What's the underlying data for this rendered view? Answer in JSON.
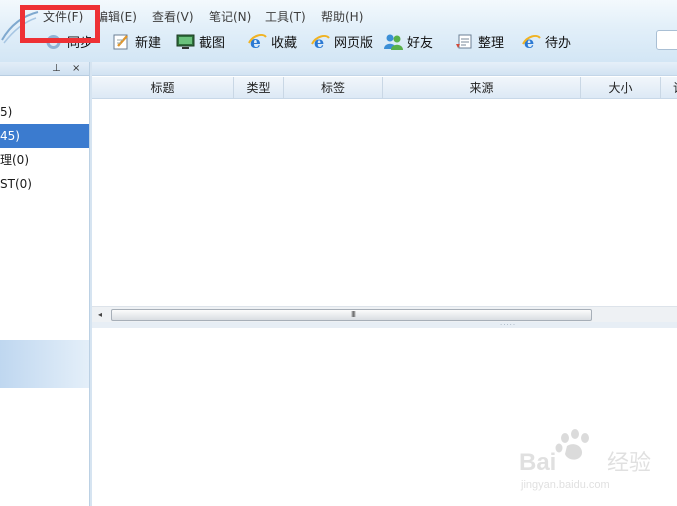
{
  "menubar": {
    "items": [
      {
        "label": "文件(F)"
      },
      {
        "label": "编辑(E)"
      },
      {
        "label": "查看(V)"
      },
      {
        "label": "笔记(N)"
      },
      {
        "label": "工具(T)"
      },
      {
        "label": "帮助(H)"
      }
    ]
  },
  "toolbar": {
    "buttons": [
      {
        "label": "同步",
        "icon": "sync-icon"
      },
      {
        "label": "新建",
        "icon": "new-note-icon"
      },
      {
        "label": "截图",
        "icon": "screenshot-icon"
      },
      {
        "label": "收藏",
        "icon": "ie-favorite-icon"
      },
      {
        "label": "网页版",
        "icon": "web-version-icon"
      },
      {
        "label": "好友",
        "icon": "friends-icon"
      },
      {
        "label": "整理",
        "icon": "organize-icon"
      },
      {
        "label": "待办",
        "icon": "todo-icon"
      }
    ]
  },
  "left_panel": {
    "pin_glyph": "⊥",
    "close_glyph": "×",
    "tree_items": [
      {
        "label": "5)",
        "selected": false
      },
      {
        "label": "45)",
        "selected": true
      },
      {
        "label": "理(0)",
        "selected": false
      },
      {
        "label": "ST(0)",
        "selected": false
      }
    ]
  },
  "list_view": {
    "columns": [
      "标题",
      "类型",
      "标签",
      "来源",
      "大小",
      "记"
    ]
  },
  "scrollbar": {
    "left_arrow": "◂",
    "grip": "III"
  },
  "watermark": {
    "brand": "Bai",
    "brand_suffix": "经验",
    "url": "jingyan.baidu.com"
  },
  "colors": {
    "highlight": "#ee3135",
    "selection": "#3b7bcf",
    "toolbar_bg": "#d3e6f5"
  }
}
